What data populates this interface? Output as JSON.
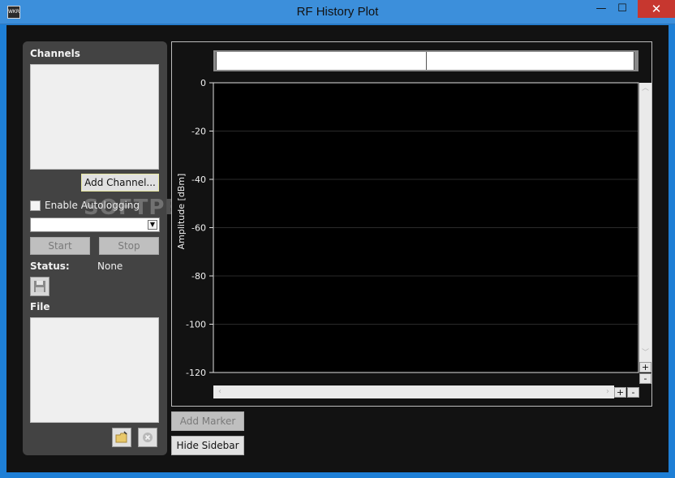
{
  "window": {
    "title": "RF History Plot",
    "icon_text": "WKR",
    "minimize": "—",
    "maximize": "☐",
    "close": "✕"
  },
  "sidebar": {
    "channels_heading": "Channels",
    "add_channel_label": "Add Channel...",
    "autolog_label": "Enable Autologging",
    "autolog_checked": false,
    "autolog_selected": "",
    "start_label": "Start",
    "stop_label": "Stop",
    "status_label": "Status:",
    "status_value": "None",
    "file_heading": "File"
  },
  "plot": {
    "add_marker_label": "Add Marker",
    "hide_sidebar_label": "Hide Sidebar",
    "zoom_in": "+",
    "zoom_out": "-"
  },
  "watermark": "SOFTPEDIA",
  "chart_data": {
    "type": "line",
    "title": "",
    "ylabel": "Amplitude [dBm]",
    "xlabel": "",
    "ylim": [
      -120,
      0
    ],
    "yticks": [
      0,
      -20,
      -40,
      -60,
      -80,
      -100,
      -120
    ],
    "grid": true,
    "series": [],
    "background": "#000000",
    "grid_color": "#2a2a2a"
  }
}
